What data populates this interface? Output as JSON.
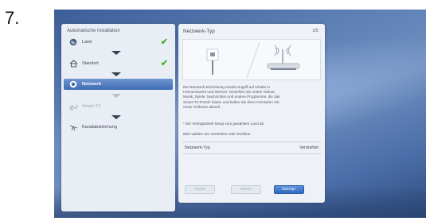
{
  "step_number": "7.",
  "wizard": {
    "title": "Automatische Installation",
    "steps": [
      {
        "label": "Land",
        "state": "done",
        "icon": "globe-icon"
      },
      {
        "label": "Standort",
        "state": "done",
        "icon": "house-icon"
      },
      {
        "label": "Netzwerk",
        "state": "active",
        "icon": "network-icon"
      },
      {
        "label": "Smart-TV",
        "state": "disabled",
        "icon": "smart-tv-icon"
      },
      {
        "label": "Kanalabstimmung",
        "state": "pending",
        "icon": "antenna-icon"
      }
    ]
  },
  "panel": {
    "title": "Netzwerk-Typ",
    "page": "1/5",
    "description_lines": [
      "Die Netzwerk-Einrichtung erlaubt Zugriff auf Inhalte in",
      "Heimnetzwerk und Internet. Genießen Sie online Videos,",
      "Musik, Spiele, Nachrichten und andere Programme, die das",
      "Smart-TV-Portal* bietet, und halten Sie Ihren Fernseher mit",
      "neuer Software aktuell."
    ],
    "note": "* Die Verfügbarkeit hängt vom gewählten Land ab",
    "prompt": "Bitte wählen Sie Verdrahtet oder Drahtlos",
    "field_label": "Netzwerk-Typ",
    "field_value": "Verdrahtet",
    "buttons": {
      "prev": "Vorher",
      "next": "Weiter",
      "skip": "Überspr."
    }
  },
  "colors": {
    "active_step": "#3e6cb2",
    "checkmark": "#49b02f",
    "primary_button": "#2f68c0"
  }
}
